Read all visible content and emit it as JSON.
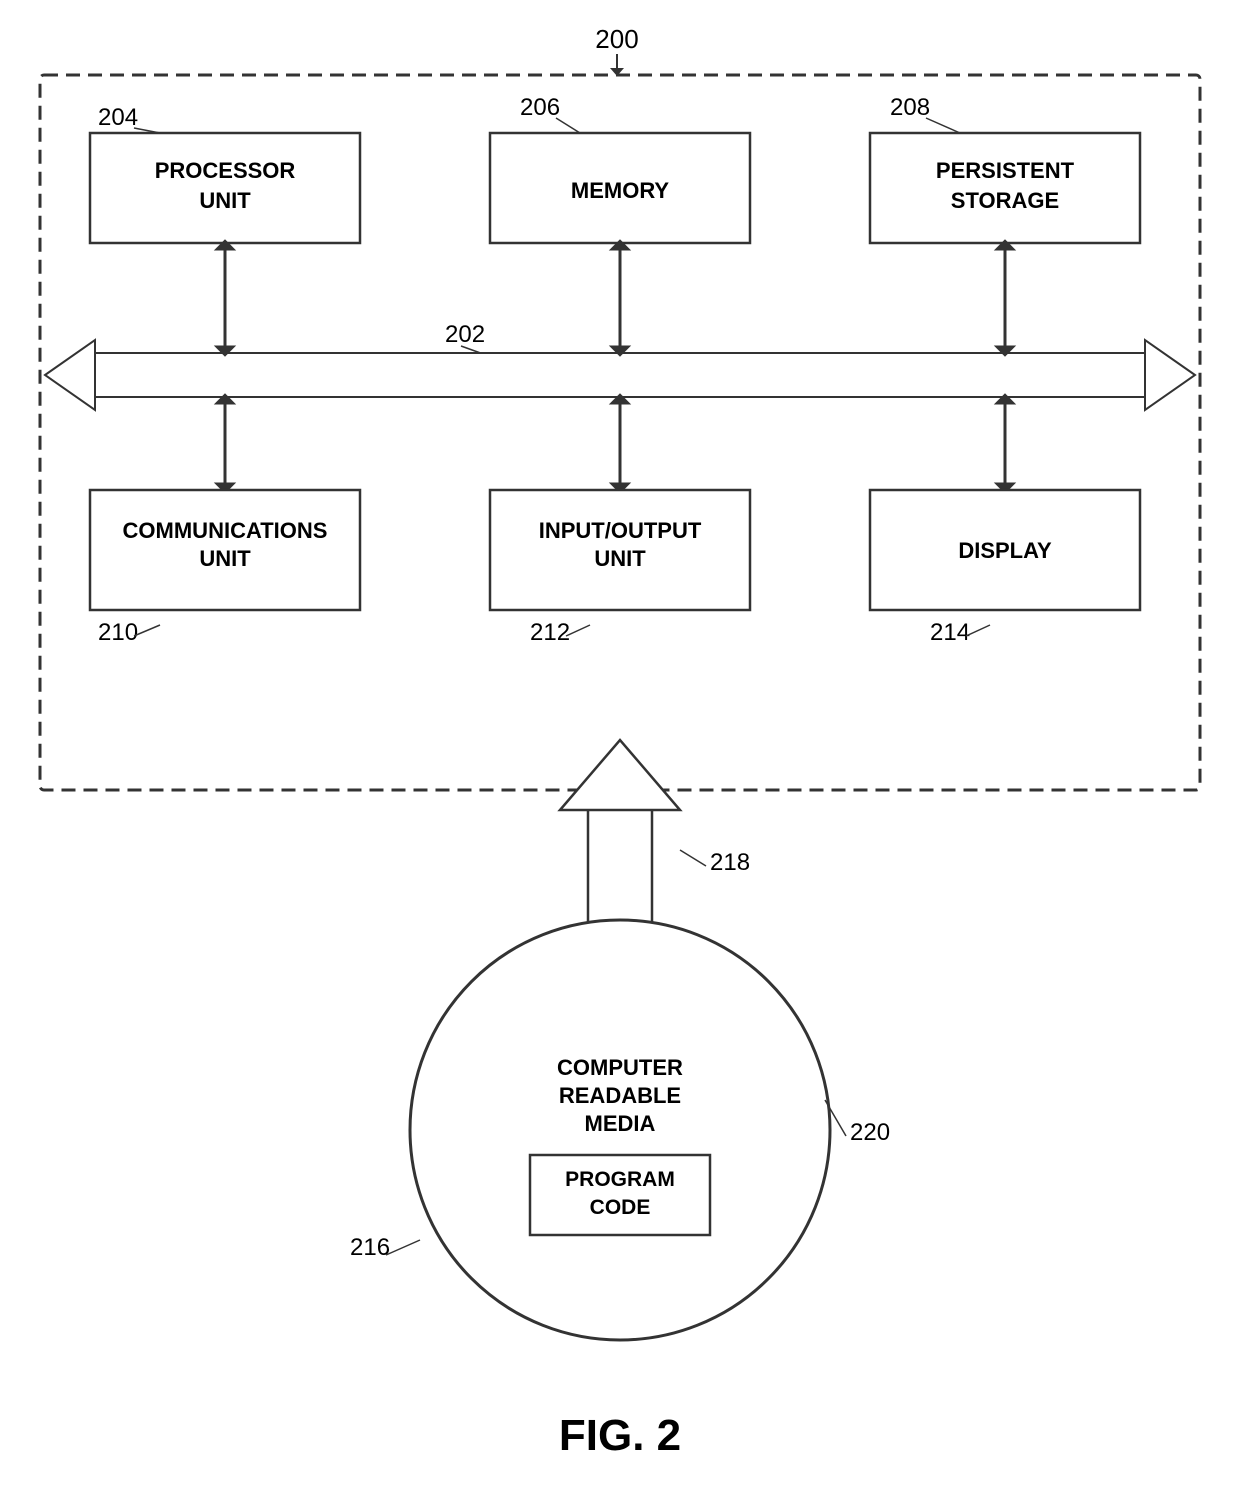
{
  "diagram": {
    "title": "FIG. 2",
    "ref_200": "200",
    "ref_202": "202",
    "ref_204": "204",
    "ref_206": "206",
    "ref_208": "208",
    "ref_210": "210",
    "ref_212": "212",
    "ref_214": "214",
    "ref_216": "216",
    "ref_218": "218",
    "ref_220": "220",
    "processor_unit": "PROCESSOR\nUNIT",
    "memory": "MEMORY",
    "persistent_storage": "PERSISTENT\nSTORAGE",
    "communications_unit": "COMMUNICATIONS\nUNIT",
    "io_unit": "INPUT/OUTPUT\nUNIT",
    "display": "DISPLAY",
    "computer_readable_media": "COMPUTER\nREADABLE\nMEDIA",
    "program_code": "PROGRAM\nCODE"
  }
}
